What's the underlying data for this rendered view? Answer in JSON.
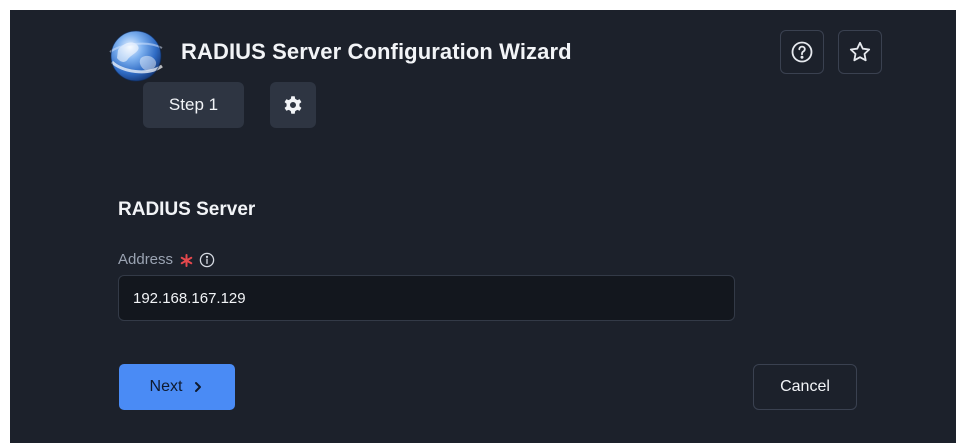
{
  "header": {
    "title": "RADIUS Server Configuration Wizard",
    "logo_icon": "globe-icon",
    "help_icon": "help-circle-icon",
    "favorite_icon": "star-icon"
  },
  "steps": {
    "current_label": "Step 1",
    "settings_icon": "gear-icon"
  },
  "form": {
    "section_title": "RADIUS Server",
    "address": {
      "label": "Address",
      "required": true,
      "info_icon": "info-circle-icon",
      "value": "192.168.167.129"
    }
  },
  "actions": {
    "next_label": "Next",
    "next_icon": "chevron-right-icon",
    "cancel_label": "Cancel"
  },
  "colors": {
    "background": "#1c212b",
    "text": "#f2f4f7",
    "muted_text": "#9aa3b2",
    "accent": "#4a8bf5",
    "required": "#e5484d",
    "chip": "#2e3542"
  }
}
